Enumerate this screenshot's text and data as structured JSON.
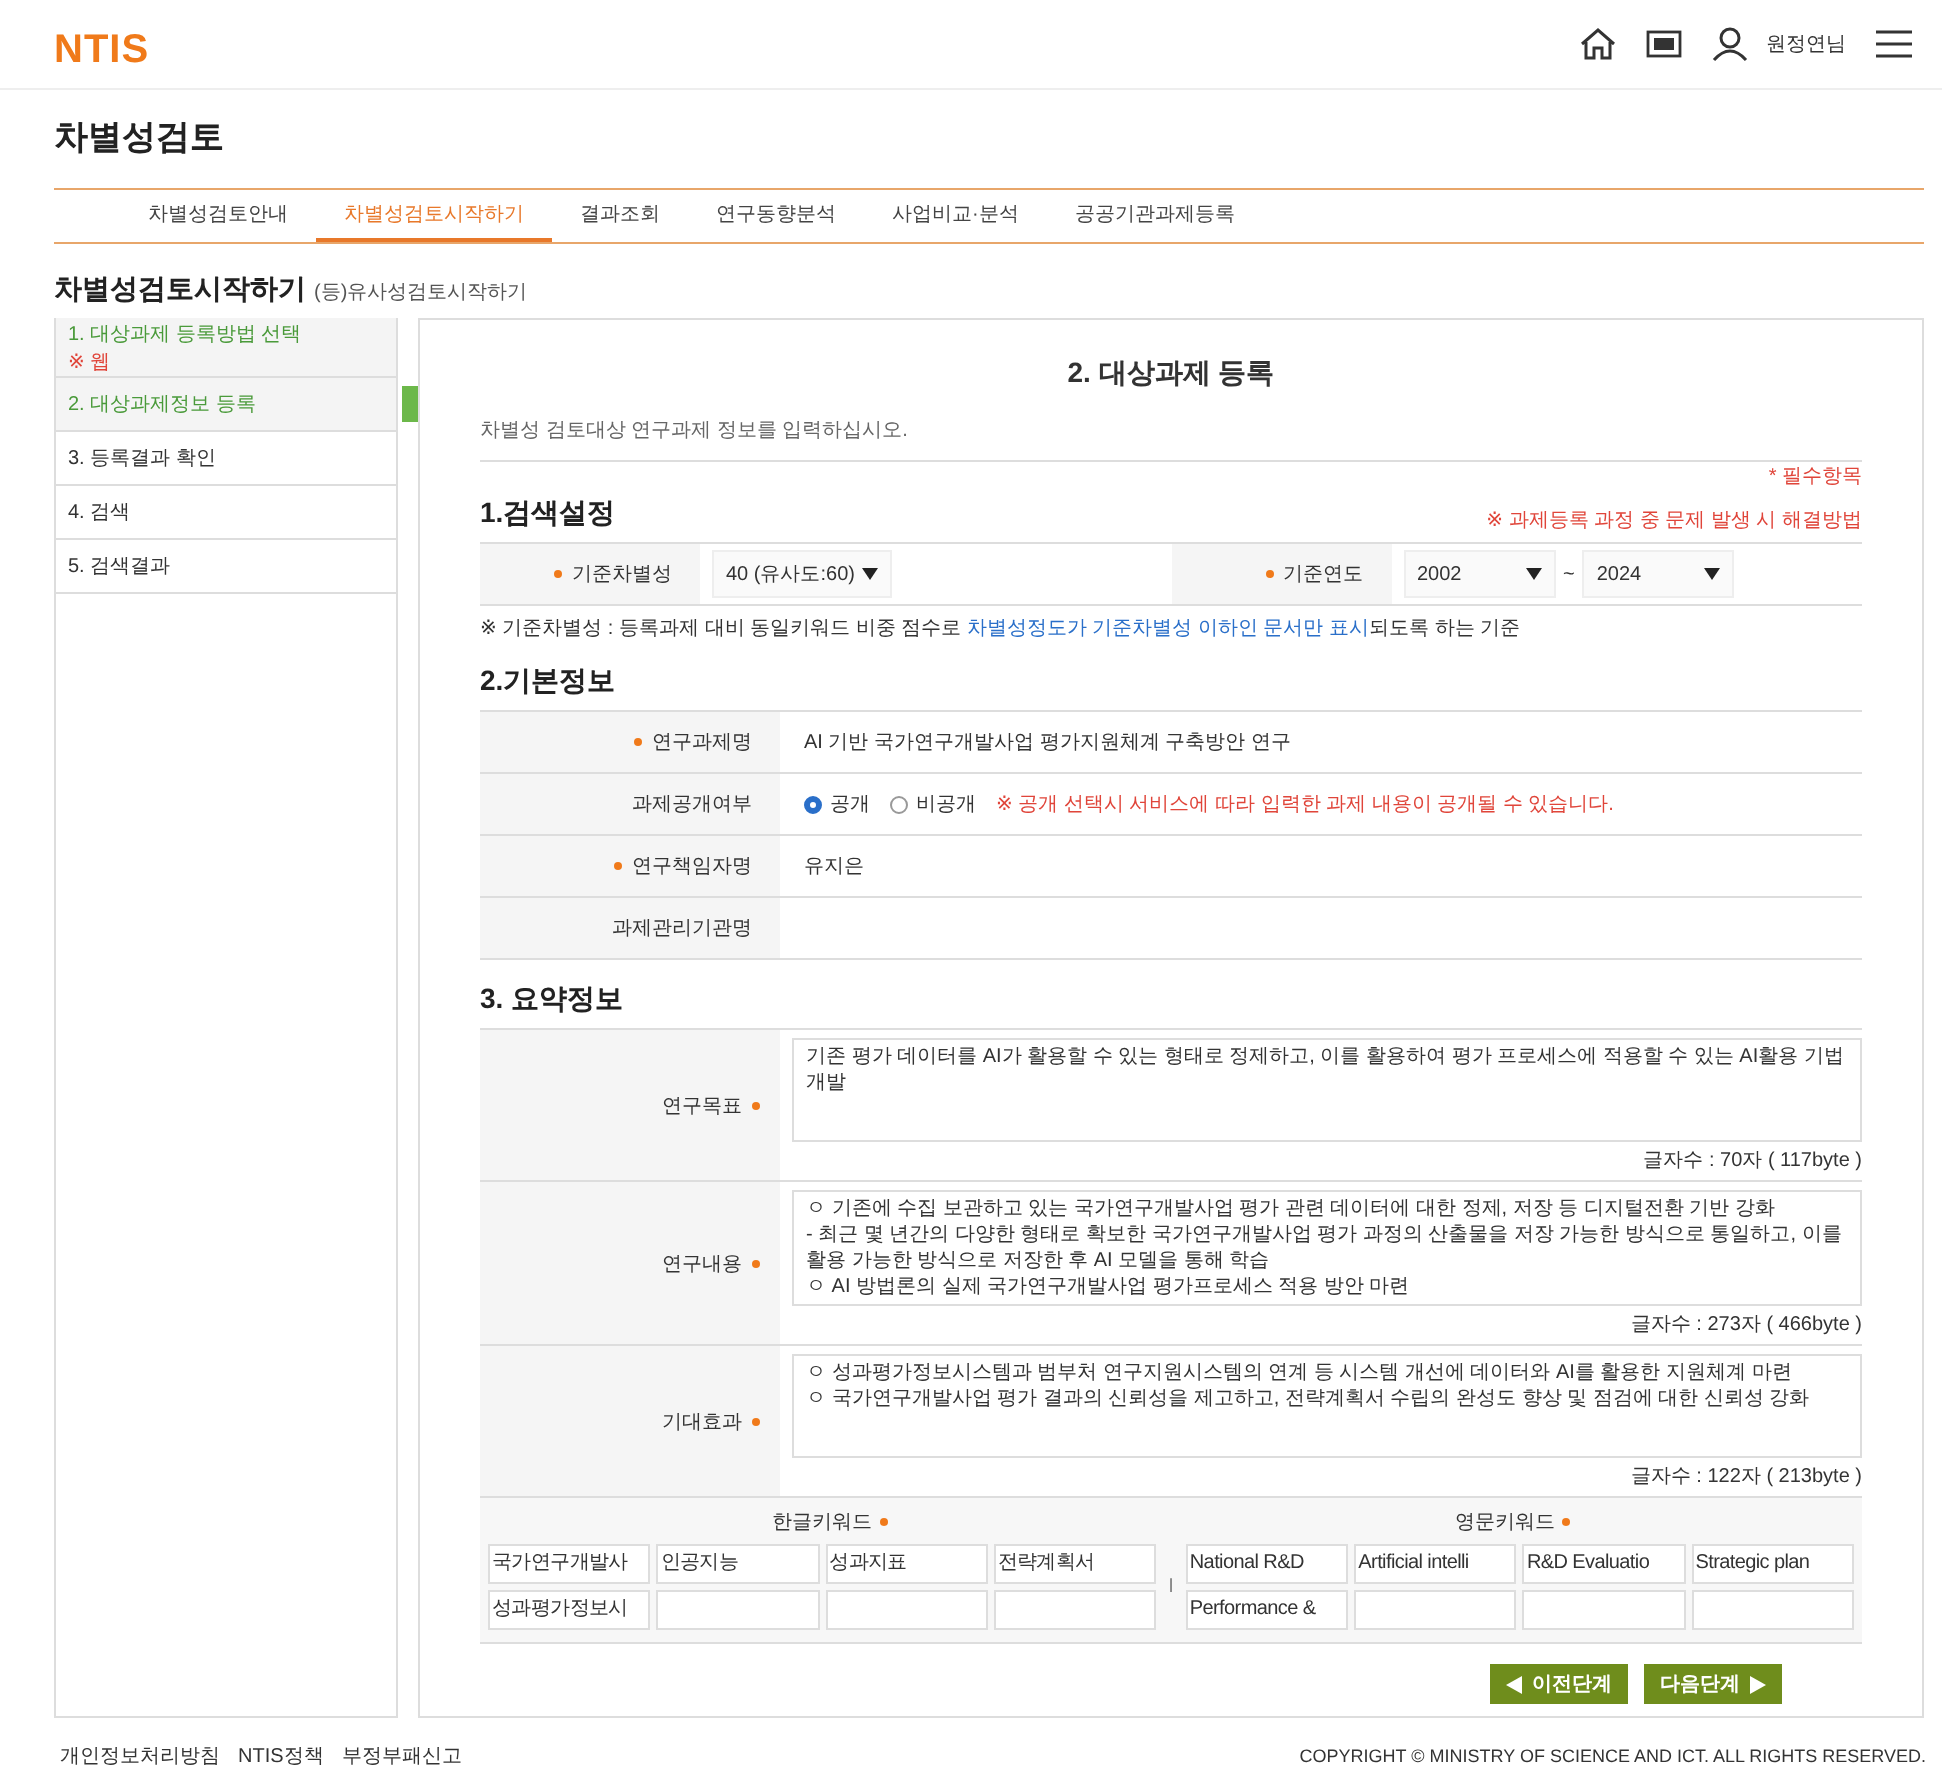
{
  "header": {
    "logo": "NTIS",
    "user": "원정연님"
  },
  "page_title": "차별성검토",
  "tabs": [
    {
      "label": "차별성검토안내",
      "selected": false
    },
    {
      "label": "차별성검토시작하기",
      "selected": true
    },
    {
      "label": "결과조회",
      "selected": false
    },
    {
      "label": "연구동향분석",
      "selected": false
    },
    {
      "label": "사업비교·분석",
      "selected": false
    },
    {
      "label": "공공기관과제등록",
      "selected": false
    }
  ],
  "section_title": "차별성검토시작하기",
  "section_subtitle": "(등)유사성검토시작하기",
  "steps": [
    {
      "label": "1. 대상과제 등록방법 선택",
      "note": "※ 웹",
      "done": true,
      "selected": false
    },
    {
      "label": "2. 대상과제정보 등록",
      "done": true,
      "selected": true
    },
    {
      "label": "3. 등록결과 확인",
      "done": false,
      "selected": false
    },
    {
      "label": "4. 검색",
      "done": false,
      "selected": false
    },
    {
      "label": "5. 검색결과",
      "done": false,
      "selected": false
    }
  ],
  "form": {
    "title": "2. 대상과제 등록",
    "intro": "차별성 검토대상 연구과제 정보를 입력하십시오.",
    "search": {
      "heading": "1.검색설정",
      "required_note": "* 필수항목",
      "help_link": "※ 과제등록 과정 중 문제 발생 시 해결방법",
      "criterion_label": "기준차별성",
      "criterion_value": "40 (유사도:60)",
      "year_label": "기준연도",
      "year_from": "2002",
      "year_sep": "~",
      "year_to": "2024",
      "footnote": "※ 기준차별성 : 등록과제 대비 동일키워드 비중 점수로 **차별성정도가 기준차별성 이하인 문서만 표시**되도록 하는 기준"
    },
    "basic": {
      "heading": "2.기본정보",
      "rows": [
        {
          "kind": "text",
          "label": "연구과제명",
          "required": true,
          "value": "AI 기반 국가연구개발사업 평가지원체계 구축방안 연구"
        },
        {
          "kind": "radio",
          "label": "과제공개여부",
          "required": false,
          "options": [
            {
              "label": "공개",
              "selected": true
            },
            {
              "label": "비공개",
              "selected": false
            }
          ],
          "warning": "※ 공개 선택시 서비스에 따라 입력한 과제 내용이 공개될 수 있습니다."
        },
        {
          "kind": "text",
          "label": "연구책임자명",
          "required": true,
          "value": "유지은"
        },
        {
          "kind": "text",
          "label": "과제관리기관명",
          "required": false
        }
      ]
    },
    "summary": {
      "heading": "3. 요약정보",
      "rows": [
        {
          "label": "연구목표",
          "required": true,
          "text": "기존 평가 데이터를 AI가 활용할 수 있는 형태로 정제하고, 이를 활용하여 평가 프로세스에 적용할 수 있는 AI활용 기법 개발",
          "count": "글자수 : 70자 ( 117byte )"
        },
        {
          "label": "연구내용",
          "required": true,
          "text": "ㅇ 기존에 수집 보관하고 있는 국가연구개발사업 평가 관련 데이터에 대한 정제, 저장 등 디지털전환 기반 강화\n- 최근 몇 년간의 다양한 형태로 확보한 국가연구개발사업 평가 과정의 산출물을 저장 가능한 방식으로 통일하고, 이를 활용 가능한 방식으로 저장한 후 AI 모델을 통해 학습\nㅇ AI 방법론의 실제 국가연구개발사업 평가프로세스 적용 방안 마련",
          "count": "글자수 : 273자 ( 466byte )"
        },
        {
          "label": "기대효과",
          "required": true,
          "text": "ㅇ 성과평가정보시스템과 범부처 연구지원시스템의 연계 등 시스템 개선에 데이터와 AI를 활용한 지원체계 마련\nㅇ 국가연구개발사업 평가 결과의 신뢰성을 제고하고, 전략계획서 수립의 완성도 향상 및 점검에 대한 신뢰성 강화",
          "count": "글자수 : 122자 ( 213byte )"
        }
      ]
    },
    "keywords": {
      "korean_label": "한글키워드",
      "english_label": "영문키워드",
      "separator": "I",
      "korean": [
        {
          "kind": "filled",
          "value": "국가연구개발사"
        },
        {
          "kind": "filled",
          "value": "인공지능"
        },
        {
          "kind": "filled",
          "value": "성과지표"
        },
        {
          "kind": "filled",
          "value": "전략계획서"
        },
        {
          "kind": "filled",
          "value": "성과평가정보시"
        },
        {
          "kind": "blank"
        },
        {
          "kind": "blank"
        },
        {
          "kind": "blank"
        }
      ],
      "english": [
        {
          "kind": "filled",
          "value": "National R&D"
        },
        {
          "kind": "filled",
          "value": "Artificial intelli"
        },
        {
          "kind": "filled",
          "value": "R&D Evaluatio"
        },
        {
          "kind": "filled",
          "value": "Strategic plan"
        },
        {
          "kind": "filled",
          "value": "Performance &"
        },
        {
          "kind": "blank"
        },
        {
          "kind": "blank"
        },
        {
          "kind": "blank"
        }
      ]
    },
    "buttons": [
      {
        "kind": "prev",
        "label": "이전단계"
      },
      {
        "kind": "next",
        "label": "다음단계"
      }
    ]
  },
  "footer": {
    "links": [
      "개인정보처리방침",
      "NTIS정책",
      "부정부패신고"
    ],
    "copyright": "COPYRIGHT © MINISTRY OF SCIENCE AND ICT. ALL RIGHTS RESERVED."
  }
}
